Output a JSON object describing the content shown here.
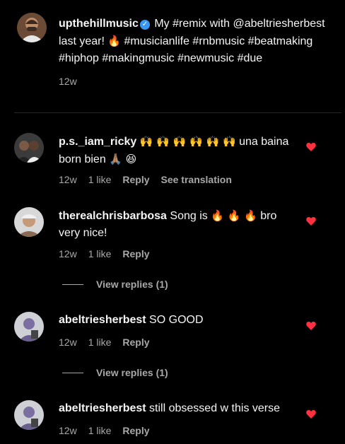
{
  "caption": {
    "username": "upthehillmusic",
    "verified_icon": "verified-badge-icon",
    "text_before": " My #remix with @abeltriesherbest last year! ",
    "emoji_fire": "🔥",
    "text_after": "  #musicianlife #rnbmusic #beatmaking #hiphop #makingmusic #newmusic #due",
    "time": "12w"
  },
  "comments": [
    {
      "username": "p.s._iam_ricky",
      "emoji_hands": "🙌 🙌 🙌 🙌 🙌 🙌",
      "text": " una baina born bien ",
      "emoji_end": "🙏🏽 😆",
      "time": "12w",
      "likes": "1 like",
      "reply": "Reply",
      "translate": "See translation"
    },
    {
      "username": "therealchrisbarbosa",
      "text_a": " Song is ",
      "emoji_fire": "🔥 🔥 🔥",
      "text_b": " bro very nice!",
      "time": "12w",
      "likes": "1 like",
      "reply": "Reply",
      "view_replies": "View replies (1)"
    },
    {
      "username": "abeltriesherbest",
      "text": " SO GOOD",
      "time": "12w",
      "likes": "1 like",
      "reply": "Reply",
      "view_replies": "View replies (1)"
    },
    {
      "username": "abeltriesherbest",
      "text": " still obsessed w this verse",
      "time": "12w",
      "likes": "1 like",
      "reply": "Reply"
    }
  ],
  "colors": {
    "heart": "#ff3040",
    "muted": "#a8a8a8",
    "verified": "#3897f0"
  },
  "icons": {
    "like": "heart-icon"
  }
}
